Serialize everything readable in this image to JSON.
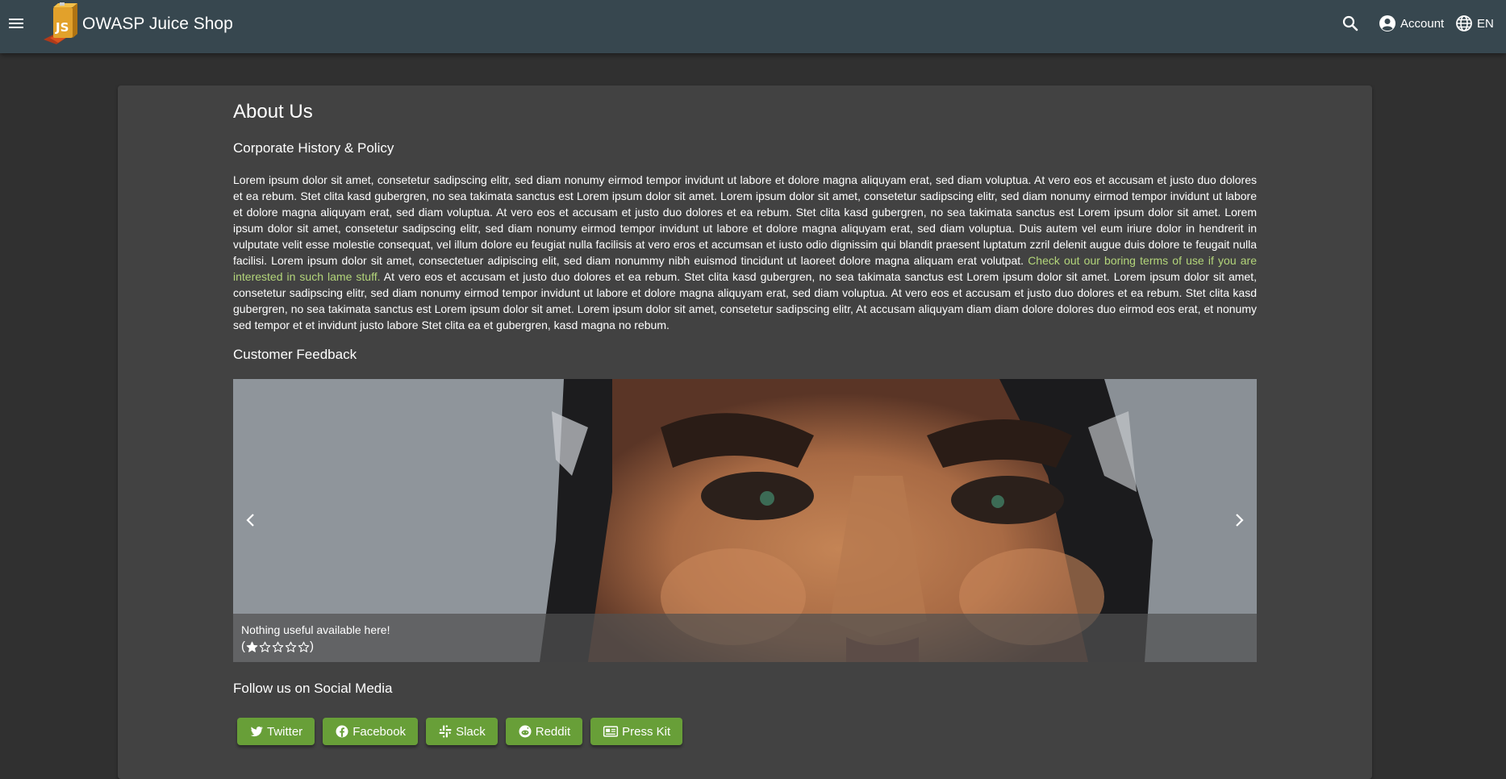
{
  "header": {
    "app_title": "OWASP Juice Shop",
    "account_label": "Account",
    "language_label": "EN",
    "logo_text": "JS",
    "bar_color": "#37474f"
  },
  "page": {
    "title": "About Us",
    "history_heading": "Corporate History & Policy",
    "history_text_before": "Lorem ipsum dolor sit amet, consetetur sadipscing elitr, sed diam nonumy eirmod tempor invidunt ut labore et dolore magna aliquyam erat, sed diam voluptua. At vero eos et accusam et justo duo dolores et ea rebum. Stet clita kasd gubergren, no sea takimata sanctus est Lorem ipsum dolor sit amet. Lorem ipsum dolor sit amet, consetetur sadipscing elitr, sed diam nonumy eirmod tempor invidunt ut labore et dolore magna aliquyam erat, sed diam voluptua. At vero eos et accusam et justo duo dolores et ea rebum. Stet clita kasd gubergren, no sea takimata sanctus est Lorem ipsum dolor sit amet. Lorem ipsum dolor sit amet, consetetur sadipscing elitr, sed diam nonumy eirmod tempor invidunt ut labore et dolore magna aliquyam erat, sed diam voluptua. Duis autem vel eum iriure dolor in hendrerit in vulputate velit esse molestie consequat, vel illum dolore eu feugiat nulla facilisis at vero eros et accumsan et iusto odio dignissim qui blandit praesent luptatum zzril delenit augue duis dolore te feugait nulla facilisi. Lorem ipsum dolor sit amet, consectetuer adipiscing elit, sed diam nonummy nibh euismod tincidunt ut laoreet dolore magna aliquam erat volutpat. ",
    "history_link": "Check out our boring terms of use if you are interested in such lame stuff.",
    "history_text_after": " At vero eos et accusam et justo duo dolores et ea rebum. Stet clita kasd gubergren, no sea takimata sanctus est Lorem ipsum dolor sit amet. Lorem ipsum dolor sit amet, consetetur sadipscing elitr, sed diam nonumy eirmod tempor invidunt ut labore et dolore magna aliquyam erat, sed diam voluptua. At vero eos et accusam et justo duo dolores et ea rebum. Stet clita kasd gubergren, no sea takimata sanctus est Lorem ipsum dolor sit amet. Lorem ipsum dolor sit amet, consetetur sadipscing elitr, At accusam aliquyam diam diam dolore dolores duo eirmod eos erat, et nonumy sed tempor et et invidunt justo labore Stet clita ea et gubergren, kasd magna no rebum.",
    "link_color": "#b3d57a",
    "feedback_heading": "Customer Feedback",
    "social_heading": "Follow us on Social Media"
  },
  "carousel": {
    "caption": "Nothing useful available here!",
    "rating_open": "(",
    "rating_close": ")",
    "rating": 1,
    "rating_max": 5
  },
  "social": {
    "buttons": [
      {
        "label": "Twitter",
        "icon": "twitter-icon"
      },
      {
        "label": "Facebook",
        "icon": "facebook-icon"
      },
      {
        "label": "Slack",
        "icon": "slack-icon"
      },
      {
        "label": "Reddit",
        "icon": "reddit-icon"
      },
      {
        "label": "Press Kit",
        "icon": "newspaper-icon"
      }
    ],
    "button_color": "#689f38"
  }
}
